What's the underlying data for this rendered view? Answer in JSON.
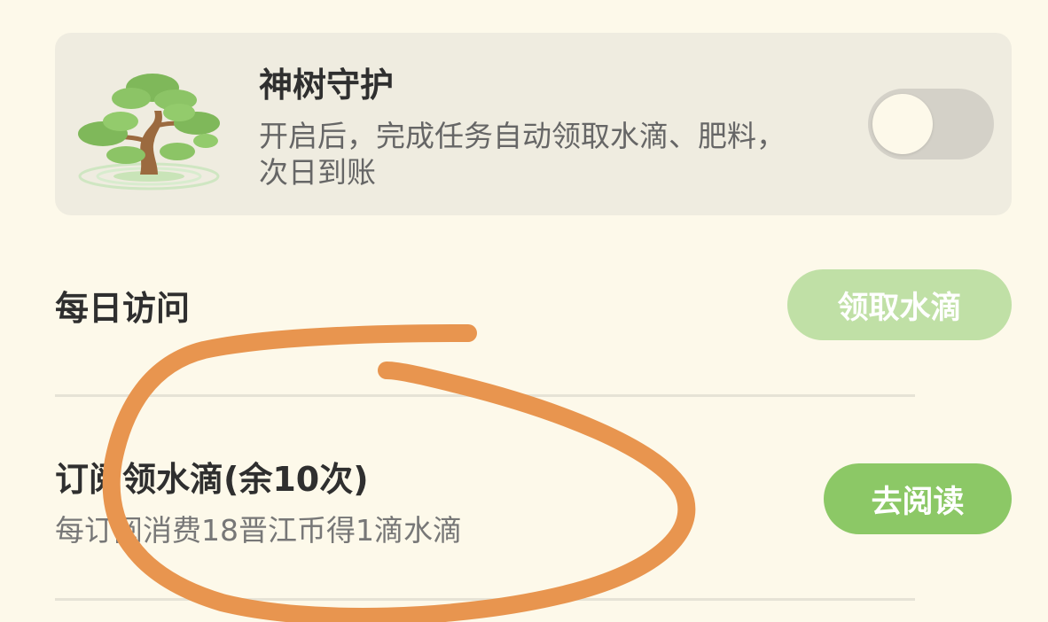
{
  "guard_card": {
    "title": "神树守护",
    "description": "开启后，完成任务自动领取水滴、肥料，次日到账",
    "toggle_on": false
  },
  "tasks": [
    {
      "title": "每日访问",
      "subtitle": "",
      "button_label": "领取水滴",
      "button_color": "#c0e0a6"
    },
    {
      "title": "订阅领水滴(余10次)",
      "subtitle": "每订阅消费18晋江币得1滴水滴",
      "button_label": "去阅读",
      "button_color": "#8cc866"
    }
  ],
  "colors": {
    "background": "#fdf9ea",
    "card": "#efece0",
    "annotation_stroke": "#e8954f"
  }
}
